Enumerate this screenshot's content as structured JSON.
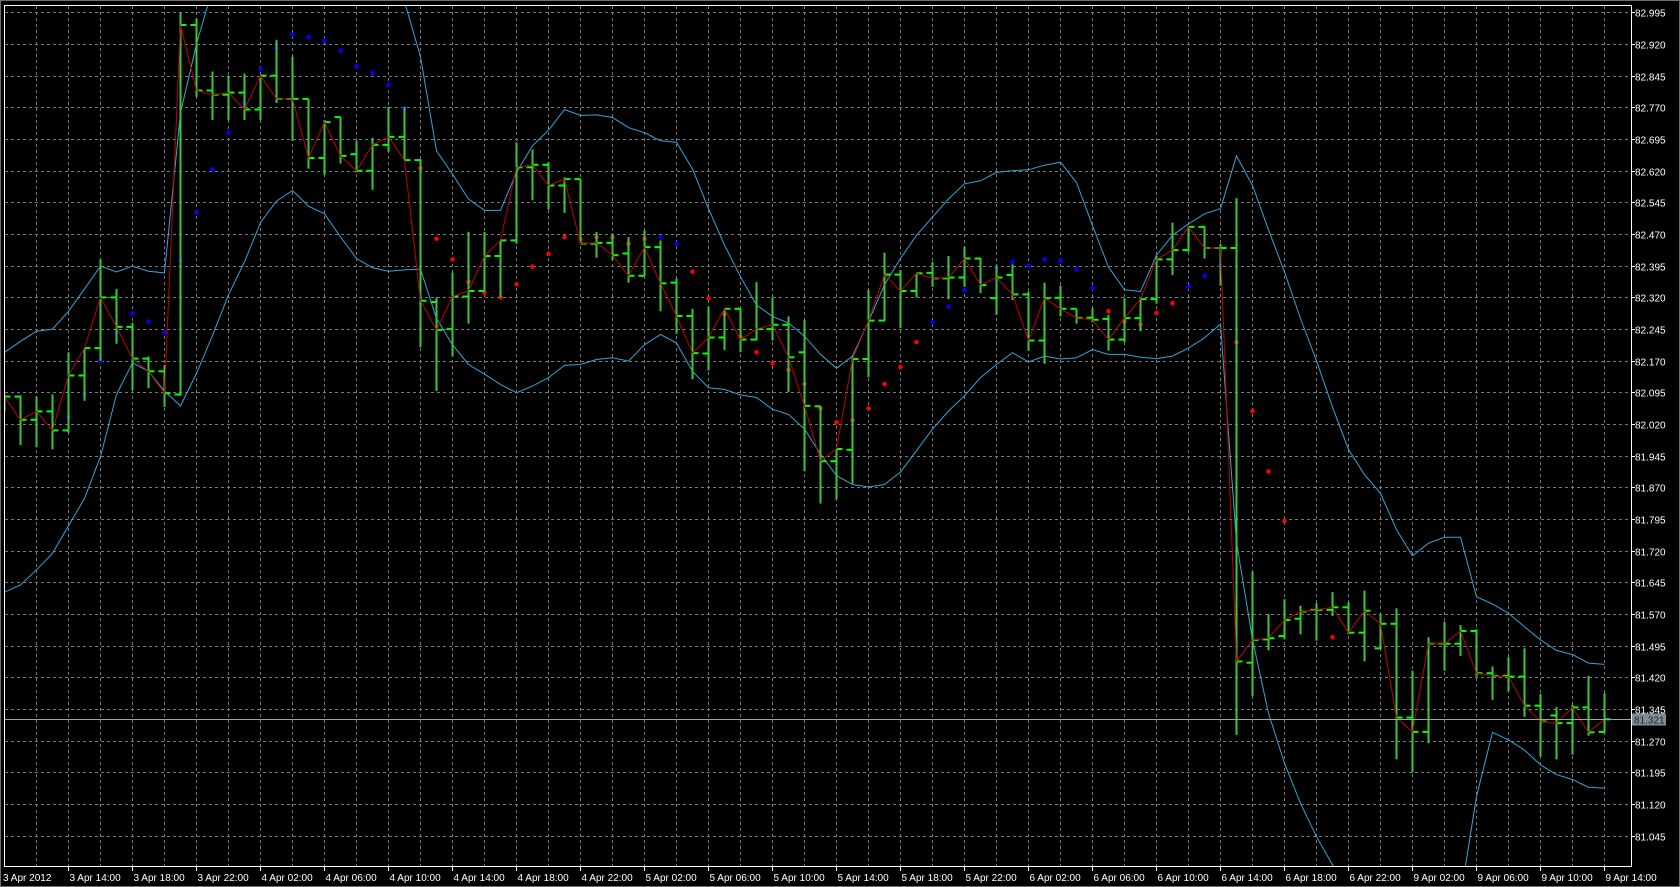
{
  "chart_data": {
    "type": "ohlc",
    "title": "",
    "timeframe": "H1",
    "y_ticks": [
      "82.995",
      "82.920",
      "82.845",
      "82.770",
      "82.695",
      "82.620",
      "82.545",
      "82.470",
      "82.395",
      "82.320",
      "82.245",
      "82.170",
      "82.095",
      "82.020",
      "81.945",
      "81.870",
      "81.795",
      "81.720",
      "81.645",
      "81.570",
      "81.495",
      "81.420",
      "81.345",
      "81.270",
      "81.195",
      "81.120",
      "81.045"
    ],
    "ylim": [
      80.973,
      83.0
    ],
    "x_ticks": [
      "3 Apr 2012",
      "3 Apr 14:00",
      "3 Apr 18:00",
      "3 Apr 22:00",
      "4 Apr 02:00",
      "4 Apr 06:00",
      "4 Apr 10:00",
      "4 Apr 14:00",
      "4 Apr 18:00",
      "4 Apr 22:00",
      "5 Apr 02:00",
      "5 Apr 06:00",
      "5 Apr 10:00",
      "5 Apr 14:00",
      "5 Apr 18:00",
      "5 Apr 22:00",
      "6 Apr 02:00",
      "6 Apr 06:00",
      "6 Apr 10:00",
      "6 Apr 14:00",
      "6 Apr 18:00",
      "6 Apr 22:00",
      "9 Apr 02:00",
      "9 Apr 06:00",
      "9 Apr 10:00",
      "9 Apr 14:00"
    ],
    "x_tick_every_bars": 4,
    "current_price": "81.321",
    "colors": {
      "bars": "#32cd32",
      "ticks": "#00ff00",
      "close_line": "#c40000",
      "bands": "#2ea6dc",
      "dot_blue": "#0000ff",
      "dot_red": "#ff0000",
      "grid": "#7a7a7a"
    },
    "ohlc": [
      [
        82.075,
        82.09,
        82.05,
        82.085
      ],
      [
        82.085,
        82.088,
        81.97,
        82.03
      ],
      [
        82.03,
        82.085,
        81.965,
        82.05
      ],
      [
        82.05,
        82.09,
        81.96,
        82.005
      ],
      [
        82.005,
        82.19,
        82.0,
        82.135
      ],
      [
        82.135,
        82.2,
        82.075,
        82.2
      ],
      [
        82.2,
        82.41,
        82.17,
        82.32
      ],
      [
        82.32,
        82.34,
        82.21,
        82.25
      ],
      [
        82.25,
        82.26,
        82.1,
        82.175
      ],
      [
        82.175,
        82.18,
        82.105,
        82.145
      ],
      [
        82.145,
        82.16,
        82.06,
        82.093
      ],
      [
        82.09,
        82.995,
        82.087,
        82.965
      ],
      [
        82.965,
        82.98,
        82.795,
        82.81
      ],
      [
        82.81,
        82.855,
        82.74,
        82.8
      ],
      [
        82.8,
        82.845,
        82.74,
        82.805
      ],
      [
        82.805,
        82.85,
        82.74,
        82.765
      ],
      [
        82.765,
        82.84,
        82.74,
        82.845
      ],
      [
        82.845,
        82.93,
        82.78,
        82.79
      ],
      [
        82.79,
        82.89,
        82.69,
        82.79
      ],
      [
        82.79,
        82.79,
        82.625,
        82.65
      ],
      [
        82.65,
        82.74,
        82.61,
        82.735
      ],
      [
        82.747,
        82.747,
        82.637,
        82.655
      ],
      [
        82.659,
        82.69,
        82.616,
        82.62
      ],
      [
        82.62,
        82.698,
        82.575,
        82.681
      ],
      [
        82.681,
        82.771,
        82.665,
        82.7
      ],
      [
        82.7,
        82.771,
        82.644,
        82.645
      ],
      [
        82.645,
        82.647,
        82.202,
        82.312
      ],
      [
        82.309,
        82.32,
        82.098,
        82.243
      ],
      [
        82.245,
        82.379,
        82.181,
        82.322
      ],
      [
        82.322,
        82.475,
        82.258,
        82.335
      ],
      [
        82.335,
        82.475,
        82.334,
        82.418
      ],
      [
        82.418,
        82.455,
        82.32,
        82.455
      ],
      [
        82.455,
        82.687,
        82.447,
        82.628
      ],
      [
        82.628,
        82.67,
        82.55,
        82.634
      ],
      [
        82.634,
        82.64,
        82.528,
        82.585
      ],
      [
        82.585,
        82.604,
        82.52,
        82.6
      ],
      [
        82.6,
        82.6,
        82.447,
        82.447
      ],
      [
        82.447,
        82.475,
        82.414,
        82.449
      ],
      [
        82.449,
        82.471,
        82.408,
        82.42
      ],
      [
        82.424,
        82.463,
        82.355,
        82.371
      ],
      [
        82.371,
        82.479,
        82.37,
        82.439
      ],
      [
        82.439,
        82.455,
        82.287,
        82.353
      ],
      [
        82.355,
        82.365,
        82.234,
        82.276
      ],
      [
        82.276,
        82.293,
        82.126,
        82.188
      ],
      [
        82.187,
        82.298,
        82.147,
        82.225
      ],
      [
        82.225,
        82.294,
        82.195,
        82.293
      ],
      [
        82.293,
        82.294,
        82.19,
        82.22
      ],
      [
        82.22,
        82.356,
        82.218,
        82.245
      ],
      [
        82.245,
        82.32,
        82.218,
        82.255
      ],
      [
        82.255,
        82.275,
        82.096,
        82.178
      ],
      [
        82.19,
        82.267,
        81.908,
        82.063
      ],
      [
        82.062,
        82.062,
        81.832,
        81.932
      ],
      [
        81.932,
        81.961,
        81.842,
        81.961
      ],
      [
        81.959,
        82.181,
        81.879,
        82.174
      ],
      [
        82.174,
        82.338,
        82.131,
        82.265
      ],
      [
        82.265,
        82.426,
        82.263,
        82.374
      ],
      [
        82.374,
        82.385,
        82.247,
        82.335
      ],
      [
        82.335,
        82.377,
        82.32,
        82.377
      ],
      [
        82.378,
        82.404,
        82.345,
        82.365
      ],
      [
        82.365,
        82.418,
        82.316,
        82.367
      ],
      [
        82.367,
        82.44,
        82.345,
        82.412
      ],
      [
        82.412,
        82.414,
        82.33,
        82.349
      ],
      [
        82.318,
        82.396,
        82.279,
        82.367
      ],
      [
        82.373,
        82.398,
        82.314,
        82.327
      ],
      [
        82.327,
        82.334,
        82.194,
        82.218
      ],
      [
        82.218,
        82.355,
        82.163,
        82.318
      ],
      [
        82.319,
        82.348,
        82.275,
        82.293
      ],
      [
        82.293,
        82.293,
        82.258,
        82.271
      ],
      [
        82.272,
        82.294,
        82.261,
        82.267
      ],
      [
        82.269,
        82.279,
        82.194,
        82.22
      ],
      [
        82.22,
        82.318,
        82.214,
        82.271
      ],
      [
        82.271,
        82.318,
        82.24,
        82.316
      ],
      [
        82.316,
        82.418,
        82.305,
        82.41
      ],
      [
        82.41,
        82.497,
        82.373,
        82.432
      ],
      [
        82.432,
        82.489,
        82.428,
        82.487
      ],
      [
        82.487,
        82.489,
        82.412,
        82.437
      ],
      [
        82.437,
        82.447,
        82.348,
        82.437
      ],
      [
        82.437,
        82.555,
        81.284,
        81.458
      ],
      [
        81.455,
        81.671,
        81.376,
        81.509
      ],
      [
        81.51,
        81.57,
        81.484,
        81.513
      ],
      [
        81.518,
        81.605,
        81.51,
        81.556
      ],
      [
        81.559,
        81.59,
        81.522,
        81.576
      ],
      [
        81.58,
        81.596,
        81.507,
        81.58
      ],
      [
        81.58,
        81.622,
        81.566,
        81.586
      ],
      [
        81.586,
        81.598,
        81.522,
        81.526
      ],
      [
        81.526,
        81.626,
        81.458,
        81.578
      ],
      [
        81.489,
        81.57,
        81.487,
        81.547
      ],
      [
        81.547,
        81.584,
        81.226,
        81.325
      ],
      [
        81.325,
        81.436,
        81.195,
        81.291
      ],
      [
        81.291,
        81.515,
        81.264,
        81.5
      ],
      [
        81.5,
        81.552,
        81.436,
        81.5
      ],
      [
        81.5,
        81.544,
        81.471,
        81.53
      ],
      [
        81.53,
        81.534,
        81.422,
        81.43
      ],
      [
        81.43,
        81.446,
        81.367,
        81.424
      ],
      [
        81.424,
        81.468,
        81.387,
        81.422
      ],
      [
        81.422,
        81.489,
        81.327,
        81.353
      ],
      [
        81.353,
        81.381,
        81.233,
        81.316
      ],
      [
        81.33,
        81.35,
        81.226,
        81.312
      ],
      [
        81.312,
        81.355,
        81.237,
        81.349
      ],
      [
        81.349,
        81.424,
        81.282,
        81.29
      ],
      [
        81.291,
        81.383,
        81.288,
        81.321
      ]
    ],
    "bollinger_upper": [
      82.19,
      82.216,
      82.24,
      82.245,
      82.287,
      82.34,
      82.394,
      82.38,
      82.394,
      82.382,
      82.378,
      82.757,
      82.92,
      83.05,
      83.12,
      83.18,
      83.22,
      83.25,
      83.27,
      83.27,
      83.26,
      83.24,
      83.2,
      83.15,
      83.08,
      83.02,
      82.89,
      82.667,
      82.612,
      82.553,
      82.526,
      82.526,
      82.616,
      82.679,
      82.716,
      82.765,
      82.751,
      82.752,
      82.746,
      82.722,
      82.71,
      82.691,
      82.687,
      82.624,
      82.53,
      82.444,
      82.369,
      82.302,
      82.275,
      82.259,
      82.228,
      82.185,
      82.152,
      82.181,
      82.263,
      82.35,
      82.412,
      82.467,
      82.51,
      82.553,
      82.589,
      82.596,
      82.616,
      82.62,
      82.622,
      82.633,
      82.64,
      82.592,
      82.49,
      82.392,
      82.338,
      82.334,
      82.42,
      82.467,
      82.494,
      82.518,
      82.53,
      82.655,
      82.585,
      82.48,
      82.38,
      82.27,
      82.17,
      82.06,
      81.96,
      81.9,
      81.856,
      81.77,
      81.708,
      81.738,
      81.752,
      81.752,
      81.611,
      81.594,
      81.572,
      81.54,
      81.509,
      81.484,
      81.474,
      81.454,
      81.451
    ],
    "bollinger_lower": [
      81.622,
      81.639,
      81.675,
      81.714,
      81.779,
      81.844,
      81.943,
      82.09,
      82.165,
      82.145,
      82.098,
      82.063,
      82.14,
      82.23,
      82.326,
      82.404,
      82.497,
      82.548,
      82.573,
      82.536,
      82.518,
      82.463,
      82.412,
      82.39,
      82.382,
      82.385,
      82.387,
      82.27,
      82.208,
      82.161,
      82.138,
      82.114,
      82.094,
      82.11,
      82.13,
      82.159,
      82.161,
      82.173,
      82.177,
      82.169,
      82.208,
      82.232,
      82.212,
      82.145,
      82.106,
      82.102,
      82.089,
      82.083,
      82.055,
      82.043,
      82.008,
      81.949,
      81.898,
      81.877,
      81.871,
      81.877,
      81.906,
      81.957,
      82.008,
      82.051,
      82.087,
      82.13,
      82.161,
      82.189,
      82.167,
      82.181,
      82.174,
      82.177,
      82.196,
      82.185,
      82.185,
      82.178,
      82.175,
      82.181,
      82.2,
      82.224,
      82.257,
      81.74,
      81.51,
      81.335,
      81.217,
      81.122,
      81.043,
      80.976,
      80.92,
      80.87,
      80.83,
      80.8,
      80.78,
      80.77,
      80.78,
      80.9,
      81.138,
      81.29,
      81.272,
      81.248,
      81.213,
      81.19,
      81.178,
      81.16,
      81.158
    ],
    "dots": [
      [
        4,
        82.037,
        "b"
      ],
      [
        5,
        82.09,
        "b"
      ],
      [
        6,
        82.17,
        "b"
      ],
      [
        7,
        82.236,
        "b"
      ],
      [
        8,
        82.282,
        "b"
      ],
      [
        9,
        82.263,
        "b"
      ],
      [
        10,
        82.237,
        "b"
      ],
      [
        11,
        82.407,
        "b"
      ],
      [
        12,
        82.52,
        "b"
      ],
      [
        13,
        82.623,
        "b"
      ],
      [
        14,
        82.71,
        "b"
      ],
      [
        15,
        82.78,
        "b"
      ],
      [
        16,
        82.86,
        "b"
      ],
      [
        17,
        82.91,
        "b"
      ],
      [
        18,
        82.942,
        "b"
      ],
      [
        19,
        82.936,
        "b"
      ],
      [
        20,
        82.928,
        "b"
      ],
      [
        21,
        82.904,
        "b"
      ],
      [
        22,
        82.867,
        "b"
      ],
      [
        23,
        82.851,
        "b"
      ],
      [
        24,
        82.823,
        "b"
      ],
      [
        25,
        82.768,
        "b"
      ],
      [
        26,
        82.626,
        "r"
      ],
      [
        27,
        82.459,
        "r"
      ],
      [
        28,
        82.41,
        "r"
      ],
      [
        29,
        82.357,
        "r"
      ],
      [
        30,
        82.331,
        "r"
      ],
      [
        31,
        82.32,
        "r"
      ],
      [
        32,
        82.351,
        "r"
      ],
      [
        33,
        82.393,
        "r"
      ],
      [
        34,
        82.423,
        "r"
      ],
      [
        35,
        82.463,
        "r"
      ],
      [
        36,
        82.457,
        "r"
      ],
      [
        37,
        82.463,
        "r"
      ],
      [
        38,
        82.462,
        "r"
      ],
      [
        39,
        82.447,
        "r"
      ],
      [
        40,
        82.459,
        "r"
      ],
      [
        41,
        82.462,
        "b"
      ],
      [
        42,
        82.447,
        "b"
      ],
      [
        43,
        82.381,
        "r"
      ],
      [
        44,
        82.318,
        "r"
      ],
      [
        45,
        82.28,
        "r"
      ],
      [
        46,
        82.226,
        "r"
      ],
      [
        47,
        82.19,
        "r"
      ],
      [
        48,
        82.164,
        "r"
      ],
      [
        49,
        82.148,
        "r"
      ],
      [
        50,
        82.115,
        "r"
      ],
      [
        51,
        82.057,
        "r"
      ],
      [
        52,
        82.024,
        "r"
      ],
      [
        53,
        82.029,
        "r"
      ],
      [
        54,
        82.057,
        "r"
      ],
      [
        55,
        82.115,
        "r"
      ],
      [
        56,
        82.155,
        "r"
      ],
      [
        57,
        82.214,
        "r"
      ],
      [
        58,
        82.261,
        "b"
      ],
      [
        59,
        82.298,
        "b"
      ],
      [
        60,
        82.336,
        "b"
      ],
      [
        61,
        82.359,
        "b"
      ],
      [
        62,
        82.39,
        "b"
      ],
      [
        63,
        82.404,
        "b"
      ],
      [
        64,
        82.395,
        "b"
      ],
      [
        65,
        82.41,
        "b"
      ],
      [
        66,
        82.406,
        "b"
      ],
      [
        67,
        82.386,
        "b"
      ],
      [
        68,
        82.343,
        "b"
      ],
      [
        69,
        82.287,
        "r"
      ],
      [
        70,
        82.263,
        "r"
      ],
      [
        71,
        82.255,
        "r"
      ],
      [
        72,
        82.283,
        "r"
      ],
      [
        73,
        82.306,
        "r"
      ],
      [
        74,
        82.345,
        "b"
      ],
      [
        75,
        82.371,
        "b"
      ],
      [
        76,
        82.395,
        "b"
      ],
      [
        77,
        82.214,
        "r"
      ],
      [
        78,
        82.051,
        "r"
      ],
      [
        79,
        81.908,
        "r"
      ],
      [
        80,
        81.79,
        "r"
      ],
      [
        83,
        81.515,
        "r"
      ]
    ]
  }
}
